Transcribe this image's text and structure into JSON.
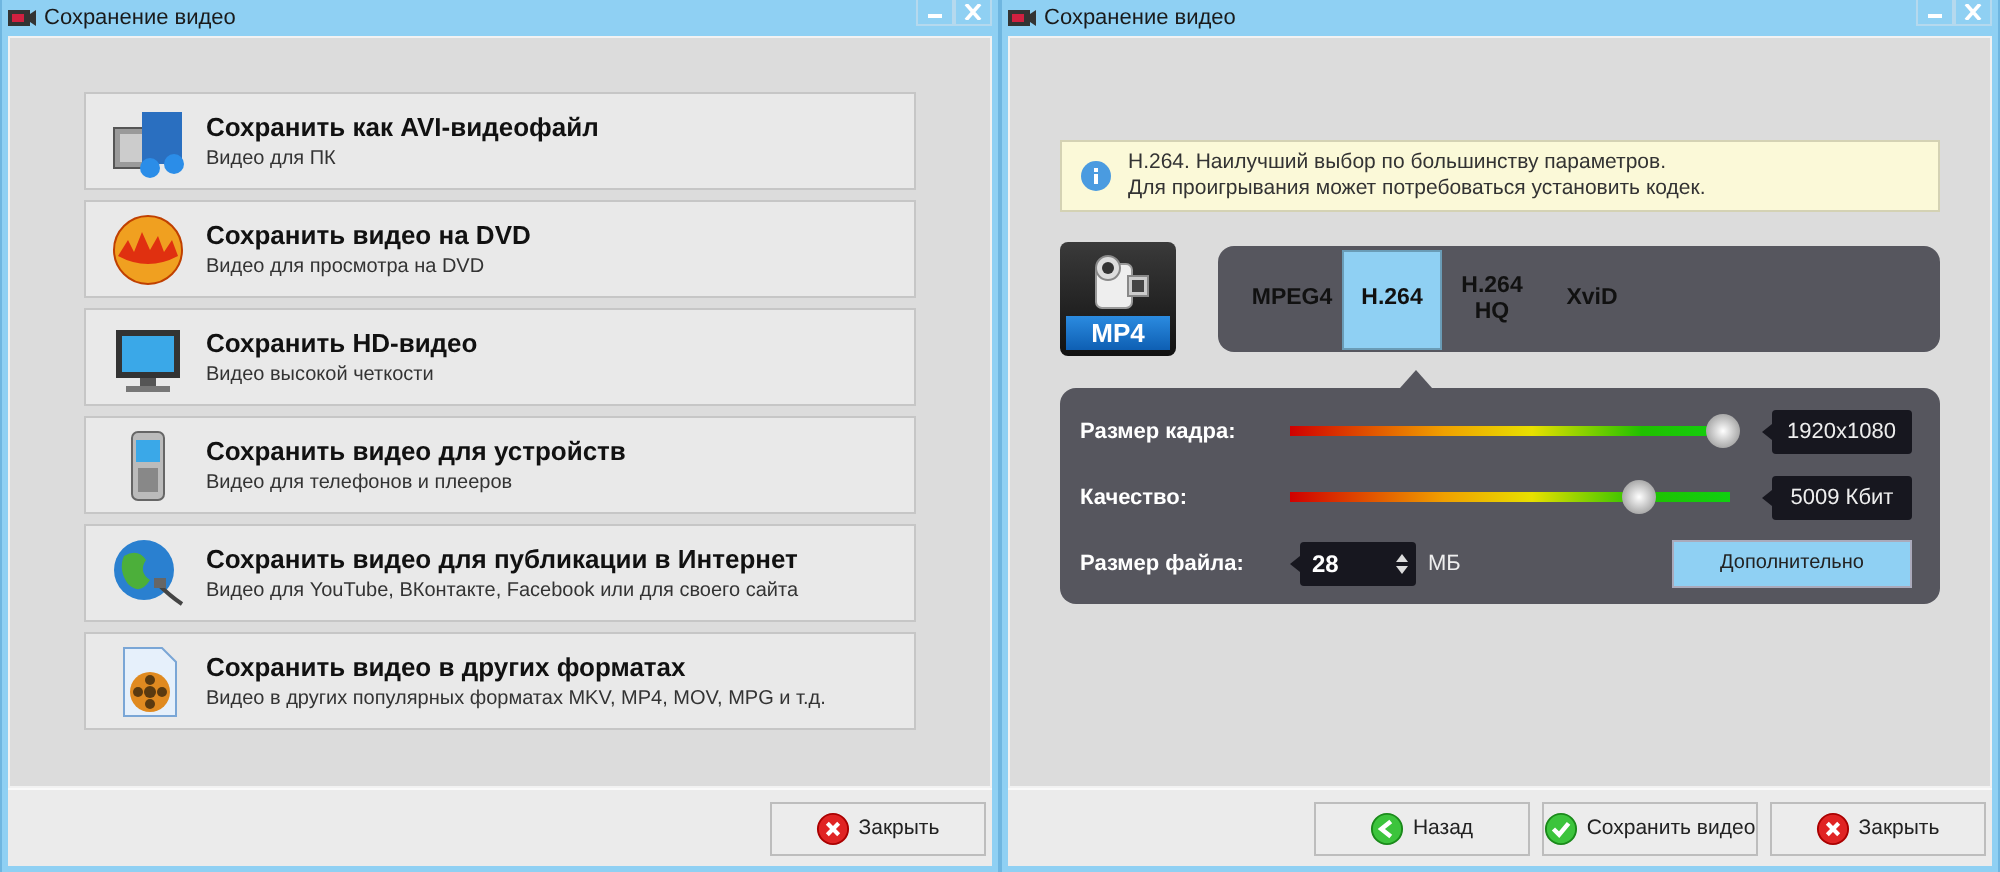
{
  "windows": [
    {
      "title": "Сохранение видео",
      "kind": "choices",
      "options": [
        {
          "kind": "avi",
          "title": "Сохранить как AVI-видеофайл",
          "subtitle": "Видео для ПК"
        },
        {
          "kind": "dvd",
          "title": "Сохранить видео на DVD",
          "subtitle": "Видео для просмотра на DVD"
        },
        {
          "kind": "hd",
          "title": "Сохранить HD-видео",
          "subtitle": "Видео высокой четкости"
        },
        {
          "kind": "device",
          "title": "Сохранить видео для устройств",
          "subtitle": "Видео для телефонов и плееров"
        },
        {
          "kind": "web",
          "title": "Сохранить видео для публикации в Интернет",
          "subtitle": "Видео для YouTube, ВКонтакте, Facebook или для своего сайта"
        },
        {
          "kind": "other",
          "title": "Сохранить видео в других форматах",
          "subtitle": "Видео в других популярных форматах MKV, MP4, MOV, MPG и т.д."
        }
      ],
      "buttons": [
        {
          "kind": "close",
          "label": "Закрыть"
        }
      ]
    },
    {
      "title": "Сохранение видео",
      "kind": "settings",
      "info": [
        "H.264. Наилучший выбор по большинству параметров.",
        "Для проигрывания может потребоваться установить кодек."
      ],
      "format": "MP4",
      "codecs": [
        {
          "label": "MPEG4",
          "selected": false
        },
        {
          "label": "H.264",
          "selected": true
        },
        {
          "label": "H.264 HQ",
          "selected": false
        },
        {
          "label": "XviD",
          "selected": false
        }
      ],
      "sliders": [
        {
          "label": "Размер кадра:",
          "level": 0.98,
          "reading": "1920x1080"
        },
        {
          "label": "Качество:",
          "level": 0.79,
          "reading": "5009 Кбит"
        }
      ],
      "file_size": {
        "label": "Размер файла:",
        "value": "28",
        "unit": "МБ"
      },
      "advanced_button": "Дополнительно",
      "buttons": [
        {
          "kind": "back",
          "label": "Назад"
        },
        {
          "kind": "save",
          "label": "Сохранить видео"
        },
        {
          "kind": "close",
          "label": "Закрыть"
        }
      ]
    }
  ]
}
